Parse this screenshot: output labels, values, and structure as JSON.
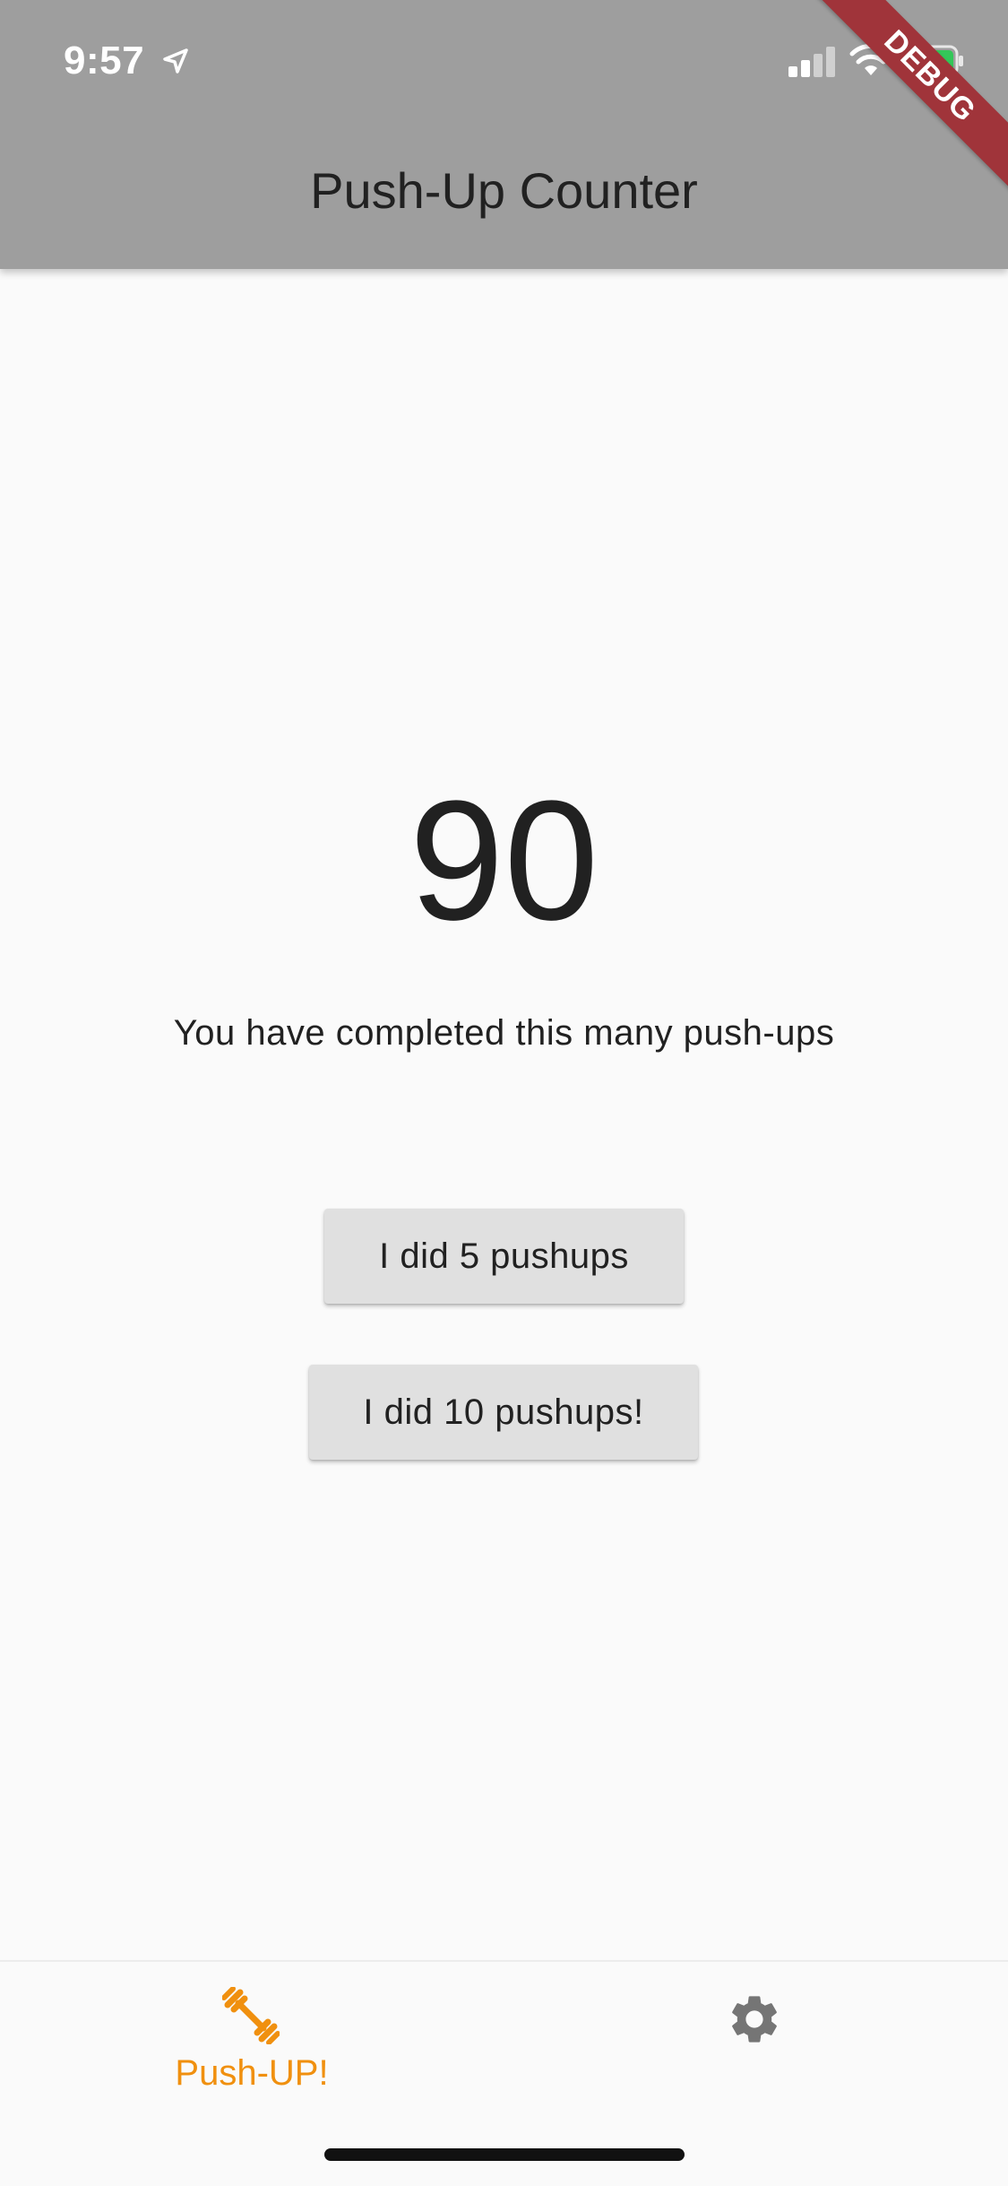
{
  "status_bar": {
    "time": "9:57"
  },
  "app_bar": {
    "title": "Push-Up Counter"
  },
  "debug_banner": {
    "label": "DEBUG"
  },
  "counter": {
    "value": "90",
    "caption": "You have completed this many push-ups"
  },
  "buttons": {
    "add_five_label": "I did 5 pushups",
    "add_ten_label": "I did 10 pushups!"
  },
  "bottom_nav": {
    "items": [
      {
        "label": "Push-UP!",
        "icon": "dumbbell-icon",
        "active": true
      },
      {
        "label": "",
        "icon": "gear-icon",
        "active": false
      }
    ]
  },
  "colors": {
    "app_bar": "#9e9e9e",
    "background": "#fafafa",
    "button": "#e0e0e0",
    "accent": "#f0900f",
    "debug_banner": "#a0343a"
  }
}
